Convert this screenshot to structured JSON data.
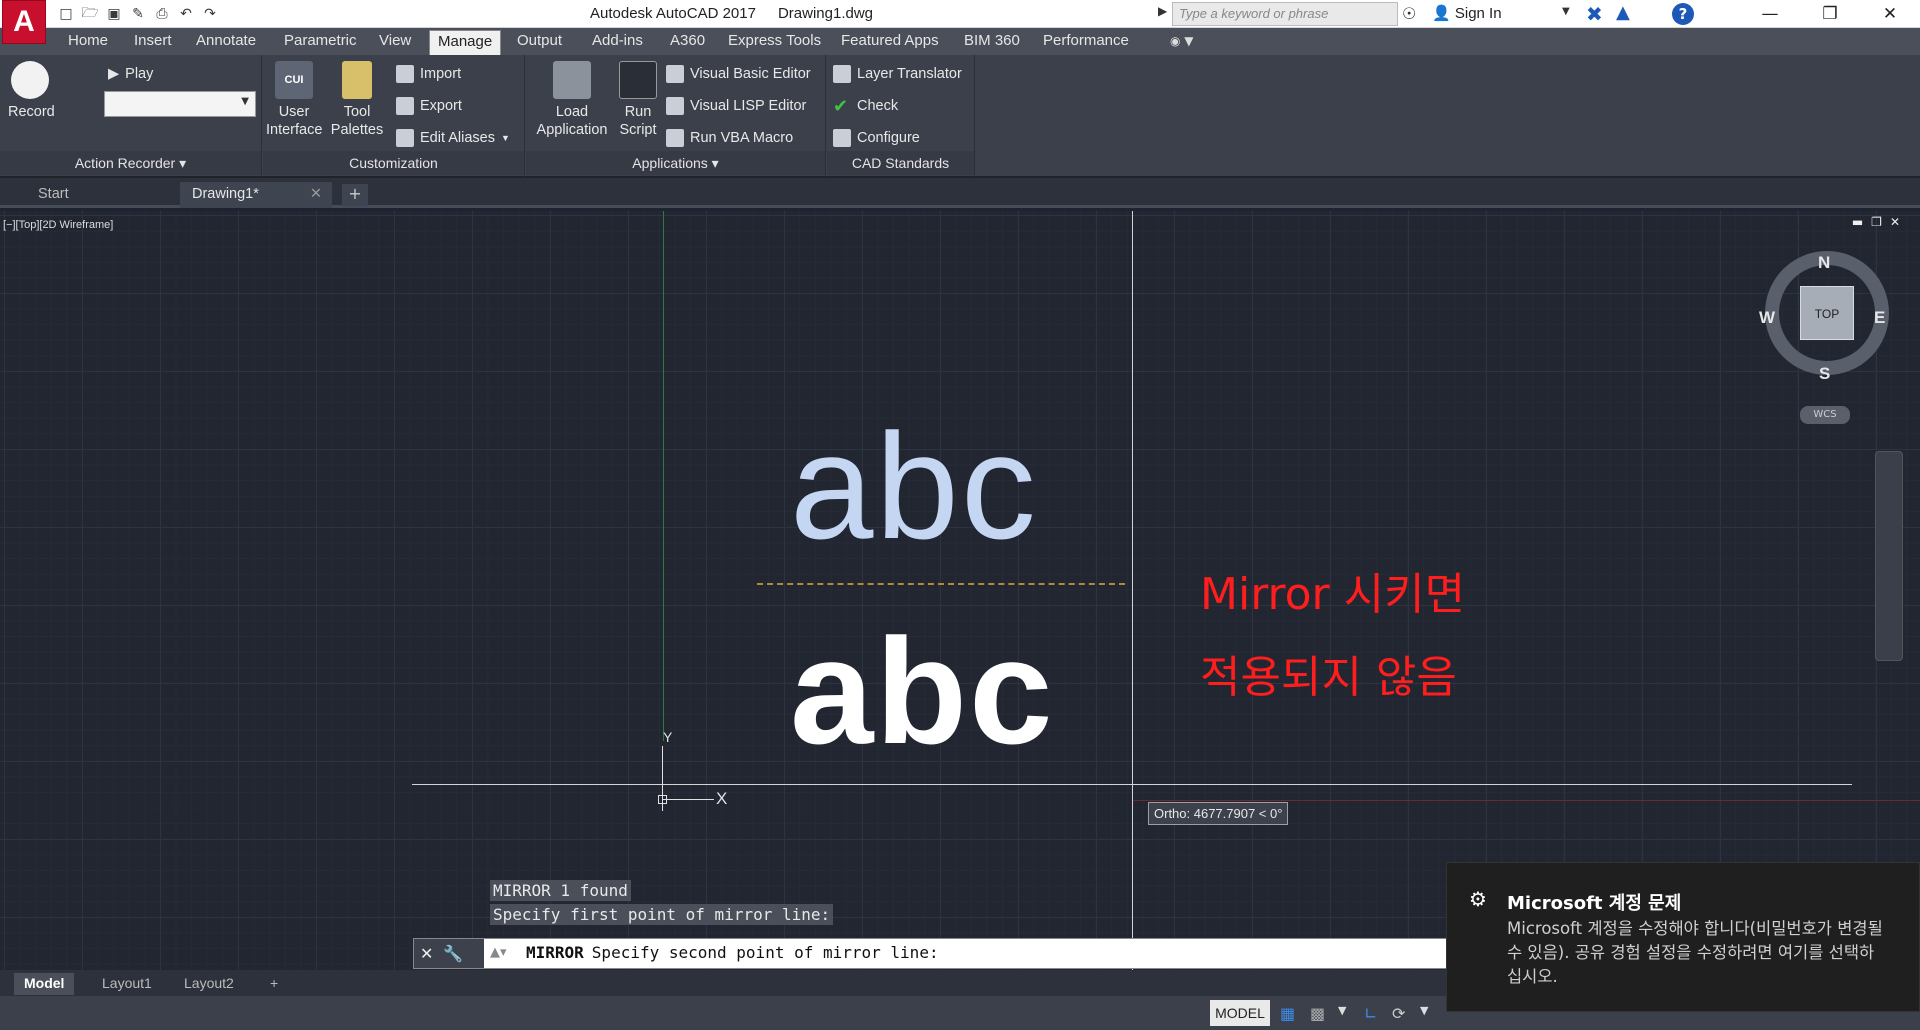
{
  "app": {
    "logo": "A",
    "title": "Autodesk AutoCAD 2017",
    "file": "Drawing1.dwg"
  },
  "quick_access": [
    "new-icon",
    "open-icon",
    "save-icon",
    "saveas-icon",
    "print-icon",
    "undo-icon",
    "redo-icon"
  ],
  "search": {
    "placeholder": "Type a keyword or phrase"
  },
  "account": {
    "sign_in": "Sign In"
  },
  "ribbon_tabs": [
    "Home",
    "Insert",
    "Annotate",
    "Parametric",
    "View",
    "Manage",
    "Output",
    "Add-ins",
    "A360",
    "Express Tools",
    "Featured Apps",
    "BIM 360",
    "Performance"
  ],
  "ribbon_active": "Manage",
  "panels": {
    "action_recorder": {
      "title": "Action Recorder",
      "record": "Record",
      "play": "Play"
    },
    "customization": {
      "title": "Customization",
      "user_interface_1": "User",
      "user_interface_2": "Interface",
      "tool_palettes_1": "Tool",
      "tool_palettes_2": "Palettes",
      "import": "Import",
      "export": "Export",
      "edit_aliases": "Edit Aliases"
    },
    "applications": {
      "title": "Applications",
      "load_1": "Load",
      "load_2": "Application",
      "run_1": "Run",
      "run_2": "Script",
      "vb": "Visual Basic Editor",
      "lisp": "Visual LISP Editor",
      "vba": "Run VBA Macro"
    },
    "cad_standards": {
      "title": "CAD Standards",
      "layer": "Layer Translator",
      "check": "Check",
      "configure": "Configure"
    }
  },
  "file_tabs": {
    "start": "Start",
    "drawing": "Drawing1*"
  },
  "viewport": {
    "label": "[−][Top][2D Wireframe]"
  },
  "drawing": {
    "text_top": "abc",
    "text_bottom": "abc",
    "note_line1": "Mirror 시키면",
    "note_line2": "적용되지 않음"
  },
  "ucs": {
    "x": "X",
    "y": "Y"
  },
  "ortho_tip": "Ortho: 4677.7907 < 0°",
  "viewcube": {
    "top": "TOP",
    "n": "N",
    "s": "S",
    "e": "E",
    "w": "W",
    "wcs": "WCS"
  },
  "command": {
    "hist1": "MIRROR 1 found",
    "hist2": "Specify first point of mirror line:",
    "current_cmd": "MIRROR",
    "current_prompt": "Specify second point of mirror line:"
  },
  "layout_tabs": {
    "model": "Model",
    "layout1": "Layout1",
    "layout2": "Layout2"
  },
  "status": {
    "model": "MODEL"
  },
  "toast": {
    "title": "Microsoft 계정 문제",
    "body": "Microsoft 계정을 수정해야 합니다(비밀번호가 변경될 수 있음). 공유 경험 설정을 수정하려면 여기를 선택하십시오."
  },
  "colors": {
    "accent": "#c8102e",
    "note": "#ff1e1e",
    "text_top": "#c5d6f2",
    "text_bottom": "#ffffff"
  }
}
